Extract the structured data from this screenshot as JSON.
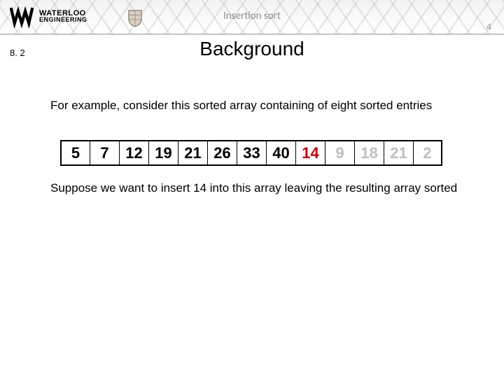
{
  "header": {
    "logo_top": "WATERLOO",
    "logo_bottom": "ENGINEERING",
    "topic": "Insertion sort",
    "page_number": "4"
  },
  "section_number": "8. 2",
  "title": "Background",
  "paragraph1": "For example, consider this sorted array containing of eight sorted entries",
  "paragraph2": "Suppose we want to insert 14 into this array leaving the resulting array sorted",
  "array_cells": {
    "c0": "5",
    "c1": "7",
    "c2": "12",
    "c3": "19",
    "c4": "21",
    "c5": "26",
    "c6": "33",
    "c7": "40",
    "c8": "14",
    "c9": "9",
    "c10": "18",
    "c11": "21",
    "c12": "2"
  },
  "chart_data": {
    "type": "table",
    "description": "Linear array of 13 cells illustrating insertion sort: first 8 sorted (black), the element to insert (red), remaining 4 unsorted (grey).",
    "cells": [
      {
        "value": 5,
        "state": "sorted"
      },
      {
        "value": 7,
        "state": "sorted"
      },
      {
        "value": 12,
        "state": "sorted"
      },
      {
        "value": 19,
        "state": "sorted"
      },
      {
        "value": 21,
        "state": "sorted"
      },
      {
        "value": 26,
        "state": "sorted"
      },
      {
        "value": 33,
        "state": "sorted"
      },
      {
        "value": 40,
        "state": "sorted"
      },
      {
        "value": 14,
        "state": "insert"
      },
      {
        "value": 9,
        "state": "unsorted"
      },
      {
        "value": 18,
        "state": "unsorted"
      },
      {
        "value": 21,
        "state": "unsorted"
      },
      {
        "value": 2,
        "state": "unsorted"
      }
    ],
    "colors": {
      "sorted": "#000000",
      "insert": "#c00000",
      "unsorted": "#bfbfbf"
    }
  }
}
